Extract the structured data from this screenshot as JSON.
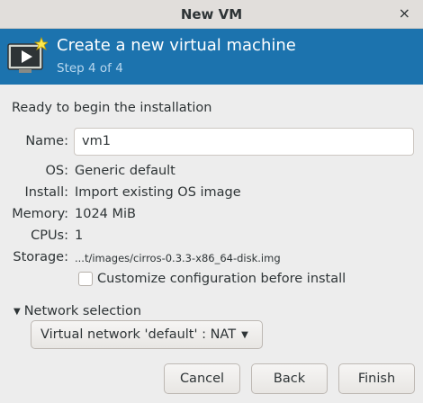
{
  "window": {
    "title": "New VM",
    "close_icon": "×"
  },
  "banner": {
    "title": "Create a new virtual machine",
    "step": "Step 4 of 4",
    "icon": "monitor-play-icon"
  },
  "summary": {
    "heading": "Ready to begin the installation",
    "name_label": "Name:",
    "name_value": "vm1",
    "os_label": "OS:",
    "os_value": "Generic default",
    "install_label": "Install:",
    "install_value": "Import existing OS image",
    "memory_label": "Memory:",
    "memory_value": "1024 MiB",
    "cpus_label": "CPUs:",
    "cpus_value": "1",
    "storage_label": "Storage:",
    "storage_value": "...t/images/cirros-0.3.3-x86_64-disk.img"
  },
  "customize": {
    "label": "Customize configuration before install",
    "checked": false
  },
  "network": {
    "expander_arrow": "▼",
    "expander_label": "Network selection",
    "selected": "Virtual network 'default' : NAT",
    "combo_arrow": "▼"
  },
  "buttons": {
    "cancel": "Cancel",
    "back": "Back",
    "finish": "Finish"
  },
  "colors": {
    "banner": "#1c73ae",
    "banner_subtitle": "#b8d7ee"
  }
}
